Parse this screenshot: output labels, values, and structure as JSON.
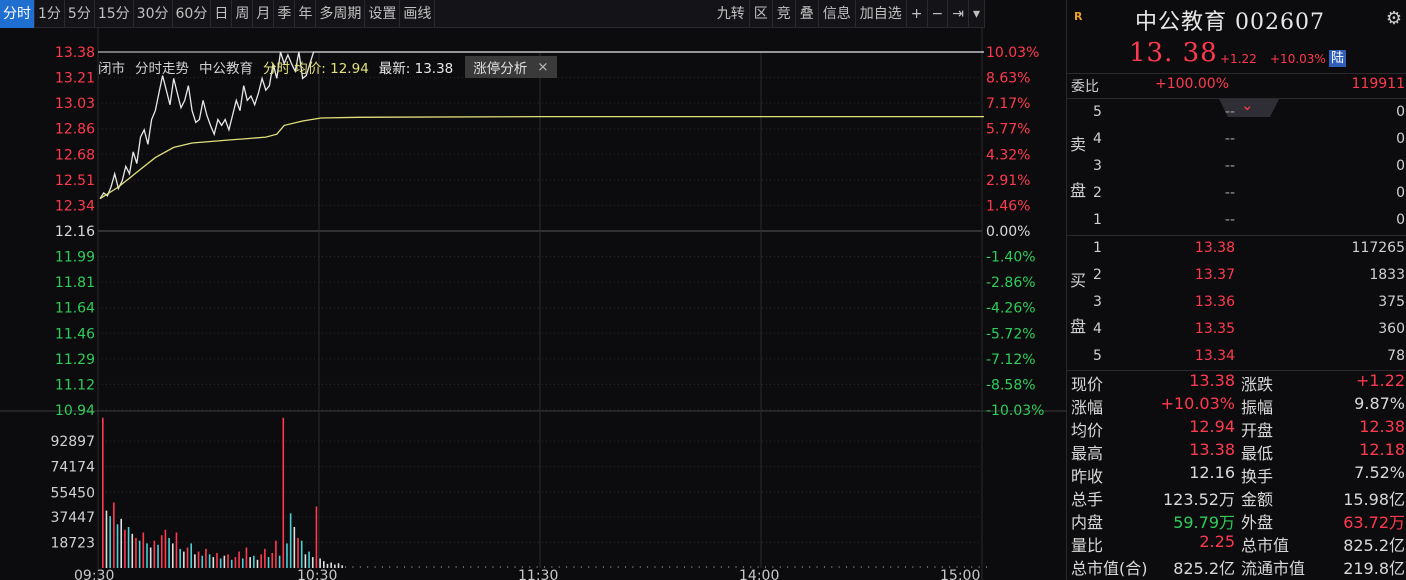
{
  "toolbar": {
    "periods": [
      "分时",
      "1分",
      "5分",
      "15分",
      "30分",
      "60分",
      "日",
      "周",
      "月",
      "季",
      "年",
      "多周期",
      "设置",
      "画线"
    ],
    "active_index": 0,
    "right_items": [
      "九转",
      "区",
      "竞",
      "叠",
      "信息",
      "加自选",
      "+",
      "−",
      "⇥",
      "▾"
    ]
  },
  "infobar": {
    "status": "闭市",
    "mode": "分时走势",
    "stock": "中公教育",
    "avg_label": "分时 均价: 12.94",
    "latest_label": "最新: 13.38",
    "zt_button": "涨停分析",
    "close_glyph": "×"
  },
  "chart_data": [
    {
      "type": "line",
      "ylim": [
        10.94,
        13.38
      ],
      "price_ticks": [
        "13.38",
        "13.21",
        "13.03",
        "12.86",
        "12.68",
        "12.51",
        "12.34",
        "12.16",
        "11.99",
        "11.81",
        "11.64",
        "11.46",
        "11.29",
        "11.12",
        "10.94"
      ],
      "pct_ticks": [
        "10.03%",
        "8.63%",
        "7.17%",
        "5.77%",
        "4.32%",
        "2.91%",
        "1.46%",
        "0.00%",
        "-1.40%",
        "-2.86%",
        "-4.26%",
        "-5.72%",
        "-7.12%",
        "-8.58%",
        "-10.03%"
      ],
      "time_ticks": [
        "09:30",
        "10:30",
        "11:30",
        "14:00",
        "15:00"
      ],
      "prev_close": 12.16,
      "minutes_total": 240,
      "series": [
        {
          "key": "price",
          "color": "#e8e8e8",
          "points": [
            [
              0,
              12.38
            ],
            [
              1,
              12.42
            ],
            [
              2,
              12.4
            ],
            [
              3,
              12.46
            ],
            [
              4,
              12.55
            ],
            [
              5,
              12.45
            ],
            [
              6,
              12.5
            ],
            [
              7,
              12.6
            ],
            [
              8,
              12.55
            ],
            [
              9,
              12.7
            ],
            [
              10,
              12.62
            ],
            [
              11,
              12.8
            ],
            [
              12,
              12.85
            ],
            [
              13,
              12.75
            ],
            [
              14,
              12.92
            ],
            [
              15,
              12.98
            ],
            [
              16,
              13.1
            ],
            [
              17,
              13.22
            ],
            [
              18,
              13.12
            ],
            [
              19,
              13.02
            ],
            [
              20,
              13.2
            ],
            [
              21,
              13.1
            ],
            [
              22,
              13.0
            ],
            [
              23,
              13.05
            ],
            [
              24,
              13.15
            ],
            [
              25,
              12.98
            ],
            [
              26,
              12.9
            ],
            [
              27,
              12.92
            ],
            [
              28,
              13.05
            ],
            [
              29,
              12.95
            ],
            [
              30,
              12.88
            ],
            [
              31,
              12.82
            ],
            [
              32,
              12.92
            ],
            [
              33,
              12.88
            ],
            [
              34,
              12.92
            ],
            [
              35,
              12.85
            ],
            [
              36,
              12.95
            ],
            [
              37,
              13.05
            ],
            [
              38,
              12.98
            ],
            [
              39,
              13.15
            ],
            [
              40,
              13.05
            ],
            [
              41,
              13.08
            ],
            [
              42,
              13.02
            ],
            [
              43,
              13.1
            ],
            [
              44,
              13.2
            ],
            [
              45,
              13.12
            ],
            [
              46,
              13.15
            ],
            [
              47,
              13.3
            ],
            [
              48,
              13.2
            ],
            [
              49,
              13.38
            ],
            [
              50,
              13.3
            ],
            [
              51,
              13.36
            ],
            [
              52,
              13.3
            ],
            [
              53,
              13.25
            ],
            [
              54,
              13.38
            ],
            [
              55,
              13.2
            ],
            [
              56,
              13.22
            ],
            [
              57,
              13.3
            ],
            [
              58,
              13.38
            ],
            [
              59,
              13.38
            ],
            [
              240,
              13.38
            ]
          ]
        },
        {
          "key": "avg",
          "color": "#e0e07a",
          "points": [
            [
              0,
              12.38
            ],
            [
              5,
              12.46
            ],
            [
              10,
              12.56
            ],
            [
              15,
              12.66
            ],
            [
              20,
              12.73
            ],
            [
              25,
              12.76
            ],
            [
              30,
              12.77
            ],
            [
              35,
              12.78
            ],
            [
              40,
              12.79
            ],
            [
              45,
              12.8
            ],
            [
              48,
              12.82
            ],
            [
              50,
              12.88
            ],
            [
              55,
              12.91
            ],
            [
              60,
              12.93
            ],
            [
              70,
              12.935
            ],
            [
              120,
              12.94
            ],
            [
              240,
              12.94
            ]
          ]
        }
      ]
    },
    {
      "type": "bar",
      "ylim": [
        0,
        112000
      ],
      "volume_ticks": [
        "92897",
        "74174",
        "55450",
        "37447",
        "18723"
      ],
      "series": [
        {
          "key": "volume",
          "values": [
            {
              "t": 0,
              "v": 110000,
              "c": "r"
            },
            {
              "t": 1,
              "v": 42000,
              "c": "w"
            },
            {
              "t": 2,
              "v": 38000,
              "c": "c"
            },
            {
              "t": 3,
              "v": 48000,
              "c": "r"
            },
            {
              "t": 4,
              "v": 32000,
              "c": "c"
            },
            {
              "t": 5,
              "v": 36000,
              "c": "w"
            },
            {
              "t": 6,
              "v": 28000,
              "c": "r"
            },
            {
              "t": 7,
              "v": 30000,
              "c": "c"
            },
            {
              "t": 8,
              "v": 25000,
              "c": "w"
            },
            {
              "t": 9,
              "v": 22000,
              "c": "r"
            },
            {
              "t": 10,
              "v": 20000,
              "c": "c"
            },
            {
              "t": 11,
              "v": 26000,
              "c": "r"
            },
            {
              "t": 12,
              "v": 18000,
              "c": "c"
            },
            {
              "t": 13,
              "v": 15000,
              "c": "w"
            },
            {
              "t": 14,
              "v": 20000,
              "c": "r"
            },
            {
              "t": 15,
              "v": 17000,
              "c": "c"
            },
            {
              "t": 16,
              "v": 24000,
              "c": "r"
            },
            {
              "t": 17,
              "v": 28000,
              "c": "r"
            },
            {
              "t": 18,
              "v": 22000,
              "c": "c"
            },
            {
              "t": 19,
              "v": 18000,
              "c": "w"
            },
            {
              "t": 20,
              "v": 26000,
              "c": "r"
            },
            {
              "t": 21,
              "v": 14000,
              "c": "c"
            },
            {
              "t": 22,
              "v": 12000,
              "c": "w"
            },
            {
              "t": 23,
              "v": 15000,
              "c": "r"
            },
            {
              "t": 24,
              "v": 18000,
              "c": "c"
            },
            {
              "t": 25,
              "v": 10000,
              "c": "w"
            },
            {
              "t": 26,
              "v": 12000,
              "c": "r"
            },
            {
              "t": 27,
              "v": 9000,
              "c": "c"
            },
            {
              "t": 28,
              "v": 14000,
              "c": "r"
            },
            {
              "t": 29,
              "v": 10000,
              "c": "c"
            },
            {
              "t": 30,
              "v": 8000,
              "c": "w"
            },
            {
              "t": 31,
              "v": 11000,
              "c": "r"
            },
            {
              "t": 32,
              "v": 7000,
              "c": "c"
            },
            {
              "t": 33,
              "v": 9000,
              "c": "w"
            },
            {
              "t": 34,
              "v": 10000,
              "c": "r"
            },
            {
              "t": 35,
              "v": 6000,
              "c": "c"
            },
            {
              "t": 36,
              "v": 8000,
              "c": "r"
            },
            {
              "t": 37,
              "v": 12000,
              "c": "r"
            },
            {
              "t": 38,
              "v": 7000,
              "c": "c"
            },
            {
              "t": 39,
              "v": 15000,
              "c": "r"
            },
            {
              "t": 40,
              "v": 8000,
              "c": "w"
            },
            {
              "t": 41,
              "v": 9000,
              "c": "c"
            },
            {
              "t": 42,
              "v": 6000,
              "c": "w"
            },
            {
              "t": 43,
              "v": 10000,
              "c": "r"
            },
            {
              "t": 44,
              "v": 14000,
              "c": "r"
            },
            {
              "t": 45,
              "v": 8000,
              "c": "c"
            },
            {
              "t": 46,
              "v": 11000,
              "c": "r"
            },
            {
              "t": 47,
              "v": 20000,
              "c": "r"
            },
            {
              "t": 48,
              "v": 9000,
              "c": "c"
            },
            {
              "t": 49,
              "v": 110000,
              "c": "r"
            },
            {
              "t": 50,
              "v": 18000,
              "c": "c"
            },
            {
              "t": 51,
              "v": 40000,
              "c": "c"
            },
            {
              "t": 52,
              "v": 30000,
              "c": "w"
            },
            {
              "t": 53,
              "v": 22000,
              "c": "r"
            },
            {
              "t": 54,
              "v": 20000,
              "c": "c"
            },
            {
              "t": 55,
              "v": 10000,
              "c": "w"
            },
            {
              "t": 56,
              "v": 12000,
              "c": "c"
            },
            {
              "t": 57,
              "v": 8000,
              "c": "w"
            },
            {
              "t": 58,
              "v": 45000,
              "c": "r"
            },
            {
              "t": 59,
              "v": 7000,
              "c": "w"
            },
            {
              "t": 60,
              "v": 5000,
              "c": "w"
            },
            {
              "t": 61,
              "v": 3000,
              "c": "w"
            },
            {
              "t": 62,
              "v": 4000,
              "c": "w"
            },
            {
              "t": 63,
              "v": 2500,
              "c": "w"
            },
            {
              "t": 64,
              "v": 3500,
              "c": "w"
            },
            {
              "t": 65,
              "v": 2000,
              "c": "w"
            }
          ]
        }
      ]
    }
  ],
  "quote": {
    "market_tag": "R",
    "name_code": "中公教育 002607",
    "price": "13. 38",
    "change": "+1.22",
    "pct": "+10.03%",
    "market_badge": "陆",
    "weibi_label": "委比",
    "weibi_value": "+100.00%",
    "weibi_num": "119911"
  },
  "orderbook": {
    "sell_label_1": "卖",
    "sell_label_2": "盘",
    "buy_label_1": "买",
    "buy_label_2": "盘",
    "sell": [
      {
        "lv": "5",
        "price": "--",
        "vol": "0"
      },
      {
        "lv": "4",
        "price": "--",
        "vol": "0"
      },
      {
        "lv": "3",
        "price": "--",
        "vol": "0"
      },
      {
        "lv": "2",
        "price": "--",
        "vol": "0"
      },
      {
        "lv": "1",
        "price": "--",
        "vol": "0"
      }
    ],
    "buy": [
      {
        "lv": "1",
        "price": "13.38",
        "vol": "117265"
      },
      {
        "lv": "2",
        "price": "13.37",
        "vol": "1833"
      },
      {
        "lv": "3",
        "price": "13.36",
        "vol": "375"
      },
      {
        "lv": "4",
        "price": "13.35",
        "vol": "360"
      },
      {
        "lv": "5",
        "price": "13.34",
        "vol": "78"
      }
    ]
  },
  "stats": [
    {
      "k1": "现价",
      "v1": "13.38",
      "c1": "red",
      "k2": "涨跌",
      "v2": "+1.22",
      "c2": "red"
    },
    {
      "k1": "涨幅",
      "v1": "+10.03%",
      "c1": "red",
      "k2": "振幅",
      "v2": "9.87%",
      "c2": "white"
    },
    {
      "k1": "均价",
      "v1": "12.94",
      "c1": "red",
      "k2": "开盘",
      "v2": "12.38",
      "c2": "red"
    },
    {
      "k1": "最高",
      "v1": "13.38",
      "c1": "red",
      "k2": "最低",
      "v2": "12.18",
      "c2": "red"
    },
    {
      "k1": "昨收",
      "v1": "12.16",
      "c1": "white",
      "k2": "换手",
      "v2": "7.52%",
      "c2": "white"
    },
    {
      "k1": "总手",
      "v1": "123.52万",
      "c1": "white",
      "k2": "金额",
      "v2": "15.98亿",
      "c2": "white"
    },
    {
      "k1": "内盘",
      "v1": "59.79万",
      "c1": "green",
      "k2": "外盘",
      "v2": "63.72万",
      "c2": "red"
    },
    {
      "k1": "量比",
      "v1": "2.25",
      "c1": "red",
      "k2": "总市值",
      "v2": "825.2亿",
      "c2": "white"
    },
    {
      "k1": "总市值(合)",
      "v1": "825.2亿",
      "c1": "white",
      "k2": "流通市值",
      "v2": "219.8亿",
      "c2": "white"
    }
  ],
  "colors": {
    "up": "#ff3a4e",
    "down": "#2ecc5a",
    "grid": "#2a2a2e",
    "cyan": "#4ad0d8"
  }
}
